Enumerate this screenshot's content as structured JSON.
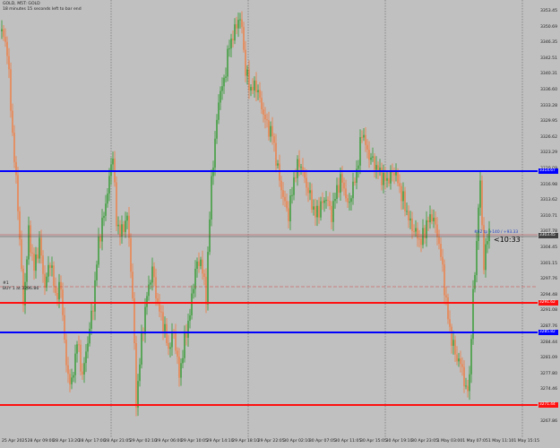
{
  "header": {
    "title": "GOLD, M5T: GOLD",
    "subtitle": "18 minutes 15 seconds left to bar end"
  },
  "order": {
    "id_label": "#1",
    "text": "BUY 1 at 3296.86"
  },
  "countdown": "<10:33",
  "tp_label": "#62 tp +140 / +93.33",
  "price_axis": [
    "3353.45",
    "3350.69",
    "3346.35",
    "3342.51",
    "3340.31",
    "3336.60",
    "3333.28",
    "3329.95",
    "3326.62",
    "3323.29",
    "3320.09",
    "3316.98",
    "3313.62",
    "3310.71",
    "3307.78",
    "3304.45",
    "3301.15",
    "3297.76",
    "3294.48",
    "3291.08",
    "3287.76",
    "3284.44",
    "3281.09",
    "3277.80",
    "3274.46",
    "3271.14",
    "3267.86"
  ],
  "time_axis": [
    "25 Apr 2025",
    "28 Apr 09:00",
    "28 Apr 13:20",
    "28 Apr 17:00",
    "28 Apr 21:05",
    "29 Apr 02:10",
    "29 Apr 06:00",
    "29 Apr 10:05",
    "29 Apr 14:10",
    "29 Apr 18:10",
    "29 Apr 22:05",
    "30 Apr 02:10",
    "30 Apr 07:05",
    "30 Apr 11:05",
    "30 Apr 15:05",
    "30 Apr 19:10",
    "30 Apr 23:05",
    "1 May 03:00",
    "1 May 07:05",
    "1 May 11:10",
    "1 May 15:15"
  ],
  "price_tags": {
    "blue_upper": "3314.67",
    "current": "3303.45",
    "red_upper": "3291.62",
    "blue_lower": "3285.82",
    "red_lower": "3271.44"
  },
  "colors": {
    "background": "#c0c0c0",
    "bull_candle": "#2e9a2e",
    "bear_candle": "#f07b3f",
    "support_line": "#ff1010",
    "resistance_line": "#0000ff",
    "bid_line": "#404040"
  }
}
